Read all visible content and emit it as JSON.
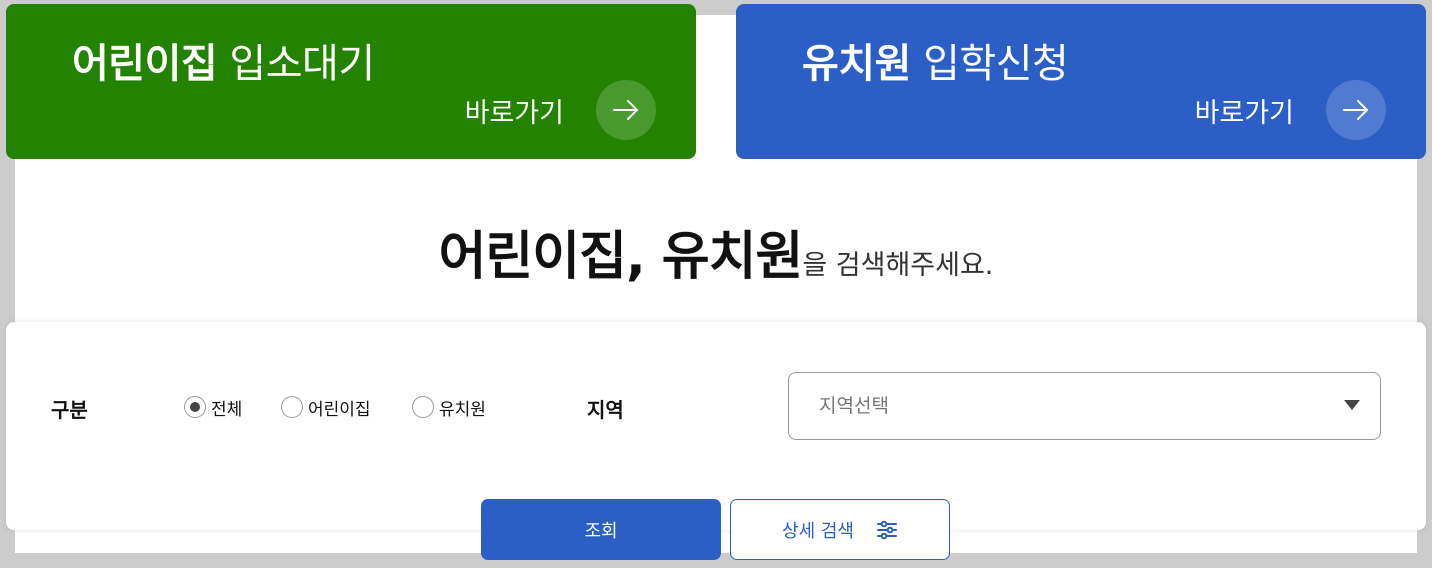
{
  "colors": {
    "daycare_green": "#238300",
    "kinder_blue": "#2b5fc6",
    "search_button": "#2b5fc6",
    "detail_text": "#2b5fc6"
  },
  "cards": {
    "daycare": {
      "title_strong": "어린이집",
      "title_light": " 입소대기",
      "go_label": "바로가기",
      "icon": "arrow-right-icon"
    },
    "kinder": {
      "title_strong": "유치원",
      "title_light": " 입학신청",
      "go_label": "바로가기",
      "icon": "arrow-right-icon"
    }
  },
  "headline": {
    "big": "어린이집, 유치원",
    "small": "을 검색해주세요."
  },
  "search": {
    "category_label": "구분",
    "category_options": [
      "전체",
      "어린이집",
      "유치원"
    ],
    "selected_category": "전체",
    "region_label": "지역",
    "region_placeholder": "지역선택",
    "search_button": "조회",
    "detail_button": "상세 검색",
    "detail_icon": "sliders-icon"
  }
}
